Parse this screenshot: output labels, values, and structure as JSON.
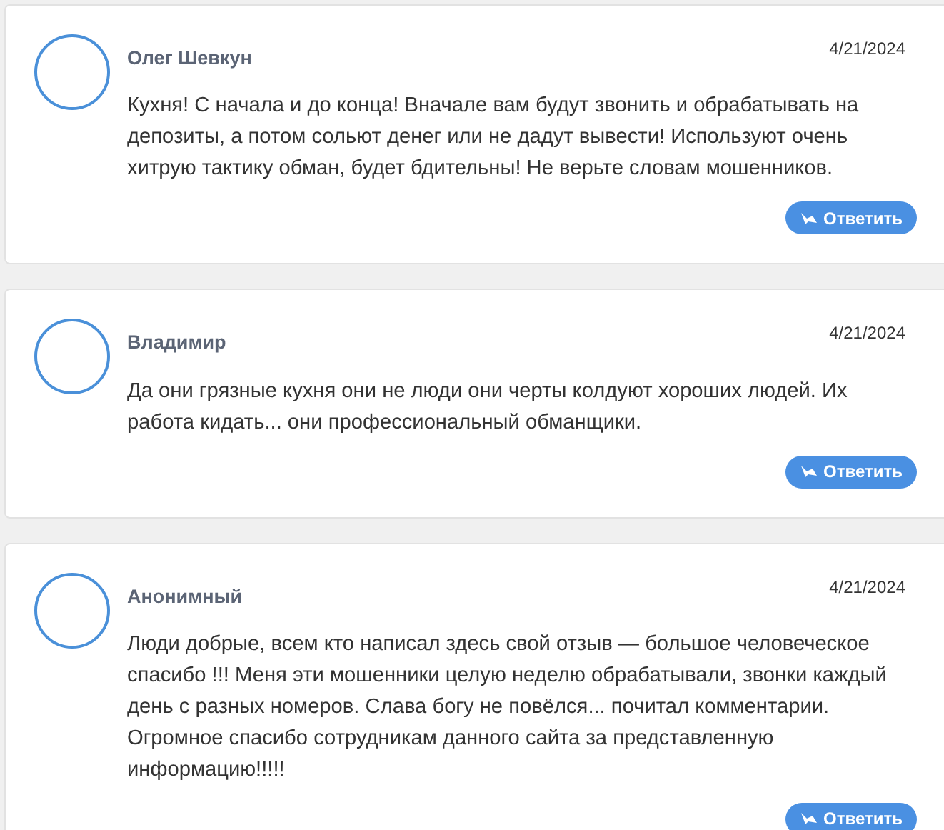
{
  "comments": [
    {
      "author": "Олег Шевкун",
      "date": "4/21/2024",
      "text": "Кухня! С начала и до конца! Вначале вам будут звонить и обрабатывать на депозиты, а потом сольют денег или не дадут вывести! Используют очень хитрую тактику обман, будет бдительны! Не верьте словам мошенников.",
      "reply": "Ответить"
    },
    {
      "author": "Владимир",
      "date": "4/21/2024",
      "text": "Да они грязные кухня они не люди они черты колдуют хороших людей. Их работа кидать... они профессиональный обманщики.",
      "reply": "Ответить"
    },
    {
      "author": "Анонимный",
      "date": "4/21/2024",
      "text": "Люди добрые, всем кто написал здесь свой отзыв — большое человеческое спасибо !!! Меня эти мошенники целую неделю обрабатывали, звонки каждый день с разных номеров. Слава богу не повёлся... почитал комментарии. Огромное спасибо сотрудникам данного сайта за представленную информацию!!!!!",
      "reply": "Ответить"
    }
  ]
}
